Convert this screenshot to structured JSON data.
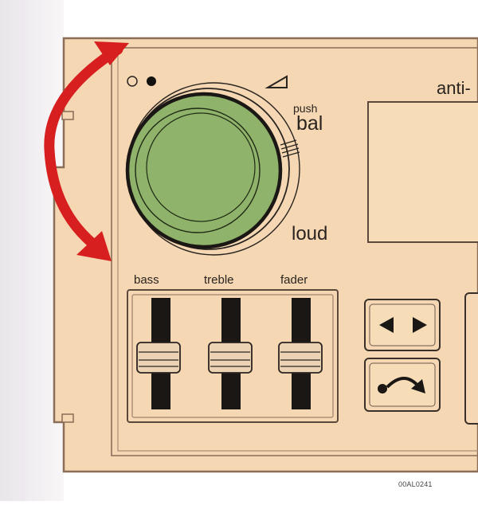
{
  "panel": {
    "display_label": "anti-",
    "knob": {
      "push_label": "push",
      "balance_label": "bal",
      "loudness_label": "loud"
    },
    "sliders": [
      {
        "label": "bass"
      },
      {
        "label": "treble"
      },
      {
        "label": "fader"
      }
    ],
    "buttons": {
      "seek": "left-right-arrows-icon",
      "next": "curved-arrow-icon"
    }
  },
  "colors": {
    "panel": "#f5d8b3",
    "panel_edge": "#9a7e68",
    "knob": "#8fb36b",
    "arrow": "#d81f1f",
    "slider_track": "#1a1715",
    "cap": "#ecd3b4"
  },
  "caption": "00AL0241"
}
